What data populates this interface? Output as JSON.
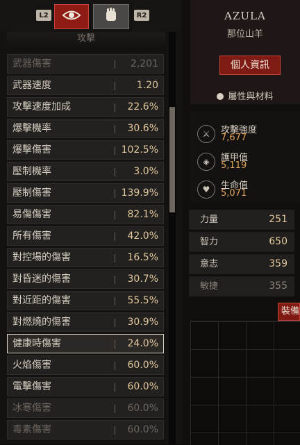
{
  "tabs": {
    "left_trigger": "L2",
    "right_trigger": "R2"
  },
  "section_title": "攻擊",
  "stats_list": [
    {
      "label": "武器傷害",
      "value": "2,201",
      "dim": true
    },
    {
      "label": "武器速度",
      "value": "1.20"
    },
    {
      "label": "攻擊速度加成",
      "value": "22.6%"
    },
    {
      "label": "爆擊機率",
      "value": "30.6%"
    },
    {
      "label": "爆擊傷害",
      "value": "102.5%"
    },
    {
      "label": "壓制機率",
      "value": "3.0%"
    },
    {
      "label": "壓制傷害",
      "value": "139.9%"
    },
    {
      "label": "易傷傷害",
      "value": "82.1%"
    },
    {
      "label": "所有傷害",
      "value": "42.0%"
    },
    {
      "label": "對控場的傷害",
      "value": "16.5%"
    },
    {
      "label": "對昏迷的傷害",
      "value": "30.7%"
    },
    {
      "label": "對近距的傷害",
      "value": "55.5%"
    },
    {
      "label": "對燃燒的傷害",
      "value": "30.9%"
    },
    {
      "label": "健康時傷害",
      "value": "24.0%",
      "selected": true
    },
    {
      "label": "火焰傷害",
      "value": "60.0%"
    },
    {
      "label": "電擊傷害",
      "value": "60.0%"
    },
    {
      "label": "冰寒傷害",
      "value": "60.0%",
      "dim": true
    },
    {
      "label": "毒素傷害",
      "value": "60.0%",
      "dim": true
    }
  ],
  "character": {
    "name": "AZULA",
    "title": "那位山羊",
    "profile_button": "個人資訊",
    "attributes_header": "屬性與材料"
  },
  "summary_stats": [
    {
      "label": "攻擊強度",
      "value": "7,677",
      "icon": "sword-icon"
    },
    {
      "label": "護甲值",
      "value": "5,119",
      "icon": "shield-icon"
    },
    {
      "label": "生命值",
      "value": "5,071",
      "icon": "heart-icon"
    }
  ],
  "core_stats": [
    {
      "label": "力量",
      "value": "251"
    },
    {
      "label": "智力",
      "value": "650"
    },
    {
      "label": "意志",
      "value": "359"
    },
    {
      "label": "敏捷",
      "value": "355",
      "dim": true
    }
  ],
  "equipment_button": "裝備"
}
